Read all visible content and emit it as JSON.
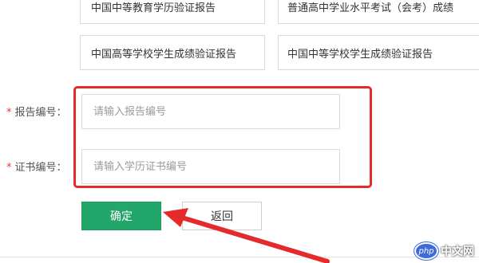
{
  "options": [
    "中国中等教育学历验证报告",
    "普通高中学业水平考试（会考）成绩",
    "中国高等学校学生成绩验证报告",
    "中国中等学校学生成绩验证报告"
  ],
  "form": {
    "report_no": {
      "required_mark": "*",
      "label": "报告编号：",
      "placeholder": "请输入报告编号"
    },
    "cert_no": {
      "required_mark": "*",
      "label": "证书编号：",
      "placeholder": "请输入学历证书编号"
    }
  },
  "buttons": {
    "confirm": "确定",
    "back": "返回"
  },
  "watermark": {
    "badge": "php",
    "text": "中文网"
  },
  "colors": {
    "highlight": "#e42a2a",
    "confirm_bg": "#22a66a",
    "required": "#e63a3a"
  }
}
